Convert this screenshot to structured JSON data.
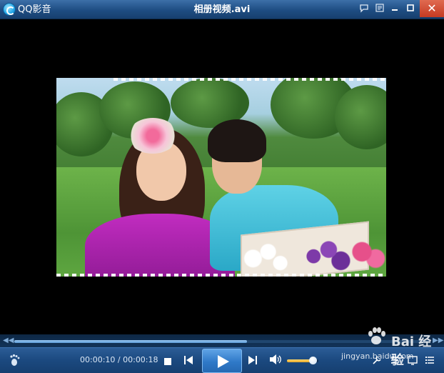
{
  "titlebar": {
    "app_name": "QQ影音",
    "window_title": "相册视频.avi",
    "icons": [
      "qqplayer-logo-icon",
      "chat-icon",
      "menu-icon",
      "minimize-icon",
      "maximize-icon",
      "close-icon"
    ]
  },
  "playback": {
    "current_time": "00:00:10",
    "separator": " / ",
    "total_time": "00:00:18",
    "progress_fraction": 0.56,
    "volume_fraction": 0.82
  },
  "controls": {
    "icons": [
      "footprint-icon",
      "stop-icon",
      "previous-icon",
      "play-icon",
      "next-icon",
      "volume-icon",
      "tools-icon",
      "equalizer-icon",
      "screen-icon",
      "playlist-icon"
    ]
  },
  "watermark": {
    "line1": "Bai 经验",
    "line2": "jingyan.baidu.com"
  },
  "colors": {
    "titlebar": "#1e4d82",
    "controlbar": "#1b497f",
    "close_button": "#c53a22",
    "accent": "#2f79c8"
  }
}
